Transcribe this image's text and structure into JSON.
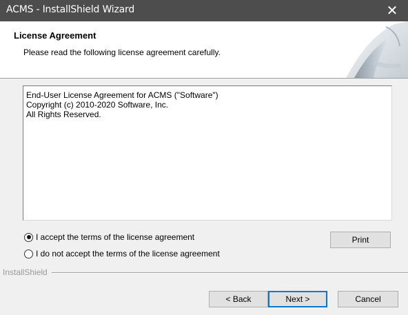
{
  "window": {
    "title": "ACMS - InstallShield Wizard",
    "close_label": "✕"
  },
  "header": {
    "title": "License Agreement",
    "subtitle": "Please read the following license agreement carefully."
  },
  "license": {
    "lines": [
      "End-User License Agreement for ACMS (\"Software\")",
      "Copyright (c) 2010-2020 Software, Inc.",
      "All Rights Reserved."
    ]
  },
  "options": {
    "accept_label": "I accept the terms of the license agreement",
    "decline_label": "I do not accept the terms of the license agreement",
    "selected": "accept"
  },
  "buttons": {
    "print": "Print",
    "back": "< Back",
    "next": "Next >",
    "cancel": "Cancel"
  },
  "branding": {
    "label": "InstallShield"
  },
  "colors": {
    "titlebar": "#4d4d4d",
    "default_button_border": "#0078d7"
  }
}
